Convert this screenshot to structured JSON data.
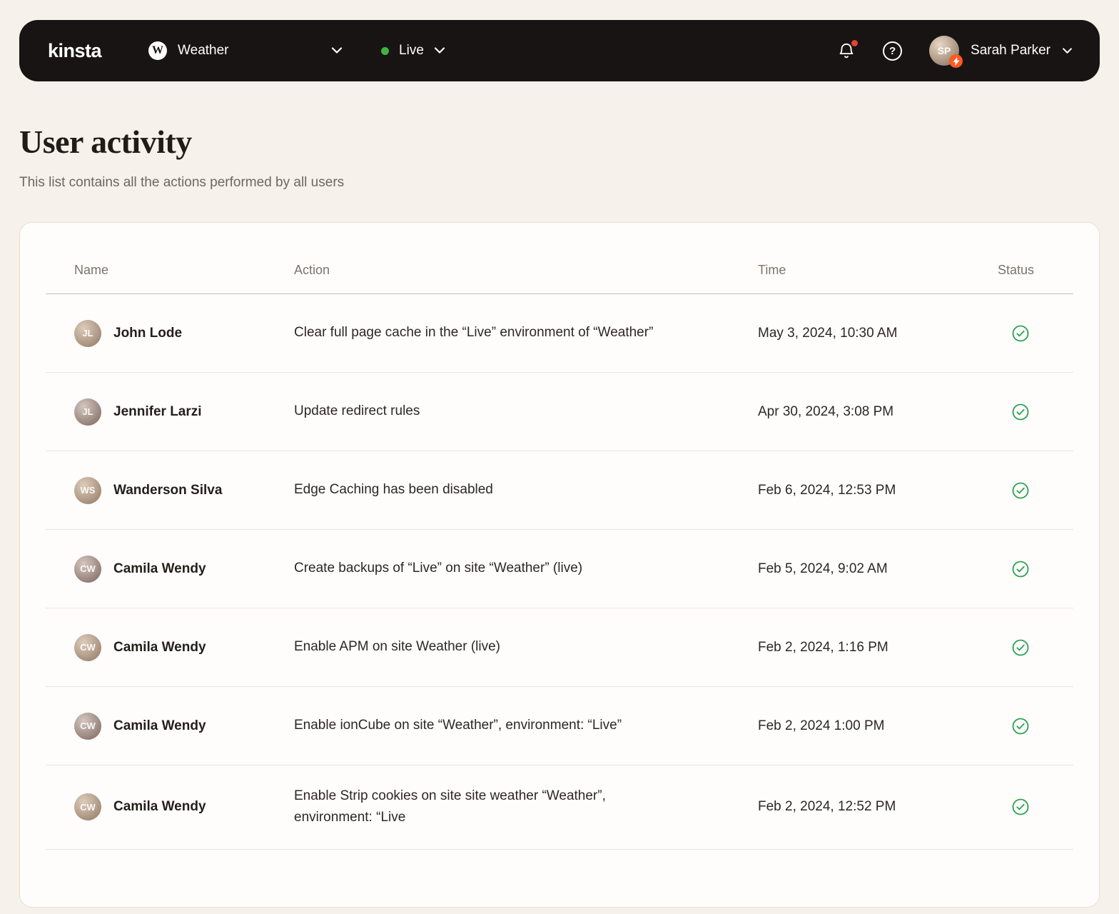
{
  "navbar": {
    "logo_text": "kinsta",
    "site_selector": {
      "label": "Weather"
    },
    "env_selector": {
      "label": "Live",
      "status_color": "#3fb43c"
    },
    "notifications": {
      "has_unread": true,
      "badge_color": "#e8432e"
    },
    "user": {
      "name": "Sarah Parker"
    }
  },
  "page": {
    "title": "User activity",
    "subtitle": "This list contains all the actions performed by all users"
  },
  "activity_table": {
    "columns": [
      "Name",
      "Action",
      "Time",
      "Status"
    ],
    "rows": [
      {
        "name": "John Lode",
        "action": "Clear full page cache in the “Live” environment of “Weather”",
        "time": "May 3, 2024, 10:30 AM",
        "status": "success"
      },
      {
        "name": "Jennifer Larzi",
        "action": "Update redirect rules",
        "time": "Apr 30, 2024, 3:08 PM",
        "status": "success"
      },
      {
        "name": "Wanderson Silva",
        "action": "Edge Caching has been disabled",
        "time": "Feb 6, 2024, 12:53 PM",
        "status": "success"
      },
      {
        "name": "Camila Wendy",
        "action": "Create backups of “Live” on site “Weather” (live)",
        "time": "Feb 5, 2024, 9:02 AM",
        "status": "success"
      },
      {
        "name": "Camila Wendy",
        "action": "Enable APM on site Weather (live)",
        "time": "Feb 2, 2024, 1:16 PM",
        "status": "success"
      },
      {
        "name": "Camila Wendy",
        "action": "Enable ionCube on site “Weather”, environment: “Live”",
        "time": "Feb 2, 2024 1:00 PM",
        "status": "success"
      },
      {
        "name": "Camila Wendy",
        "action": "Enable Strip cookies on site site weather “Weather”, environment: “Live",
        "time": "Feb 2, 2024, 12:52 PM",
        "status": "success"
      }
    ]
  },
  "colors": {
    "success_green": "#2aa152",
    "live_green": "#3fb43c",
    "notification_red": "#e8432e",
    "badge_orange": "#ff5a1f"
  }
}
